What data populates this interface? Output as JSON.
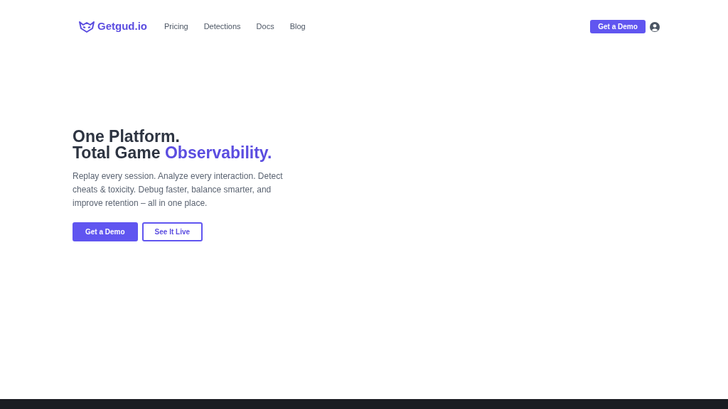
{
  "nav": {
    "logo": "Getgud.io",
    "links": [
      "Pricing",
      "Detections",
      "Docs",
      "Blog"
    ],
    "cta": "Get a Demo"
  },
  "hero": {
    "title_line_1": "One Platform.",
    "title_line_2": "Total Game ",
    "title_accent": "Observability.",
    "description": "Replay every session. Analyze every interaction. Detect cheats & toxicity. Debug faster, balance smarter, and improve retention – all in one place.",
    "buttons": [
      {
        "label": "Get a Demo",
        "kind": "primary"
      },
      {
        "label": "See It Live",
        "kind": "outline"
      }
    ]
  }
}
